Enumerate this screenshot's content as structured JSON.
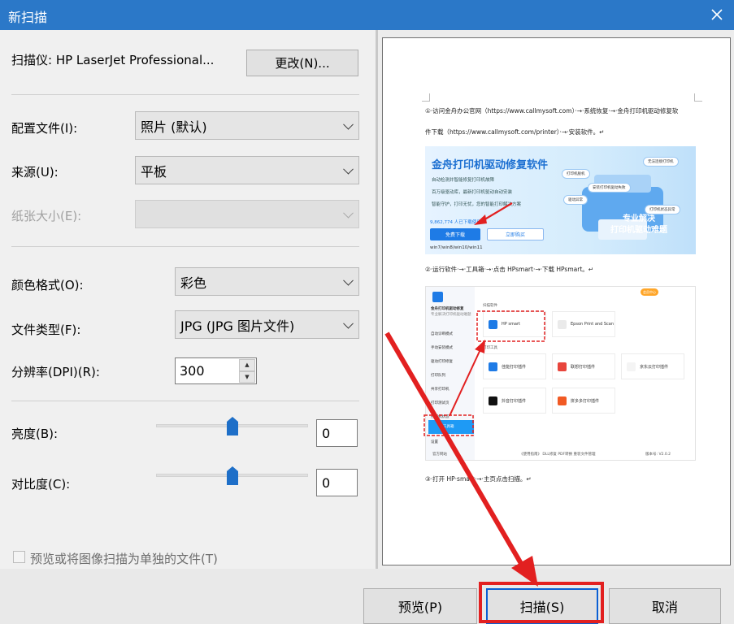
{
  "window": {
    "title": "新扫描"
  },
  "scanner": {
    "label": "扫描仪: HP LaserJet Professional...",
    "change_button": "更改(N)..."
  },
  "settings": {
    "profile": {
      "label": "配置文件(I):",
      "value": "照片 (默认)"
    },
    "source": {
      "label": "来源(U):",
      "value": "平板"
    },
    "paper_size": {
      "label": "纸张大小(E):",
      "value": ""
    },
    "color_format": {
      "label": "颜色格式(O):",
      "value": "彩色"
    },
    "file_type": {
      "label": "文件类型(F):",
      "value": "JPG (JPG 图片文件)"
    },
    "resolution": {
      "label": "分辨率(DPI)(R):",
      "value": "300"
    },
    "brightness": {
      "label": "亮度(B):",
      "value": "0",
      "level": 0.5
    },
    "contrast": {
      "label": "对比度(C):",
      "value": "0",
      "level": 0.5
    },
    "separate_files": {
      "label": "预览或将图像扫描为单独的文件(T)",
      "checked": false
    }
  },
  "preview": {
    "step1_line1": "①·访问金舟办公官网（https://www.callmysoft.com）·→·系统恢复·→·金舟打印机驱动修复软",
    "step1_line2": "件下载（https://www.callmysoft.com/printer）·→·安装软件。↵",
    "banner": {
      "title": "金舟打印机驱动修复软件",
      "features": [
        "自动检测并智能修复打印机故障",
        "百万级驱动库，最新打印机驱动自动安装",
        "智能守护，打印无忧，您的智能打印解决方案"
      ],
      "count": "9,862,774 人已下载使用",
      "download": "免费下载",
      "buy": "立即购买",
      "os": "win7/win8/win10/win11",
      "pro_line1": "专业解决",
      "pro_line2": "打印机驱动难题",
      "bubbles": [
        "无法连接打印机",
        "打印机脱机",
        "安装打印机驱动失败",
        "驱动异常",
        "打印机状态异常"
      ]
    },
    "step2": "②·运行软件·→·工具箱·→·点击 HPsmart·→·下载 HPsmart。↵",
    "app": {
      "name": "金舟打印机驱动修复",
      "subtitle": "专业解决打印机驱动难题",
      "side_items": [
        "自动诊断模式",
        "手动安装模式",
        "驱动打印修复",
        "打印队列",
        "共享打印机",
        "打印测试页",
        "打印机状态"
      ],
      "toolbox": "工具箱",
      "settings": "设置",
      "section1": "扫描软件",
      "section2": "打印工具",
      "vip": "会员中心",
      "cards": [
        "HP smart",
        "Epson Print and Scan",
        "佳能打印插件",
        "联想打印插件",
        "京东云打印插件",
        "抖音打印插件",
        "拼多多打印插件"
      ],
      "footer_left": "官方网站",
      "footer_middle": "《使用指南》 DLL修复  PDF转换  重装文件管理",
      "footer_right": "版本号: V2.0.2"
    },
    "step3": "③·打开 HP·smart·→·主页点击扫描。↵"
  },
  "buttons": {
    "preview": "预览(P)",
    "scan": "扫描(S)",
    "cancel": "取消"
  },
  "colors": {
    "titlebar": "#2b78c8",
    "highlight": "#e22020",
    "accent": "#1e7be6"
  }
}
